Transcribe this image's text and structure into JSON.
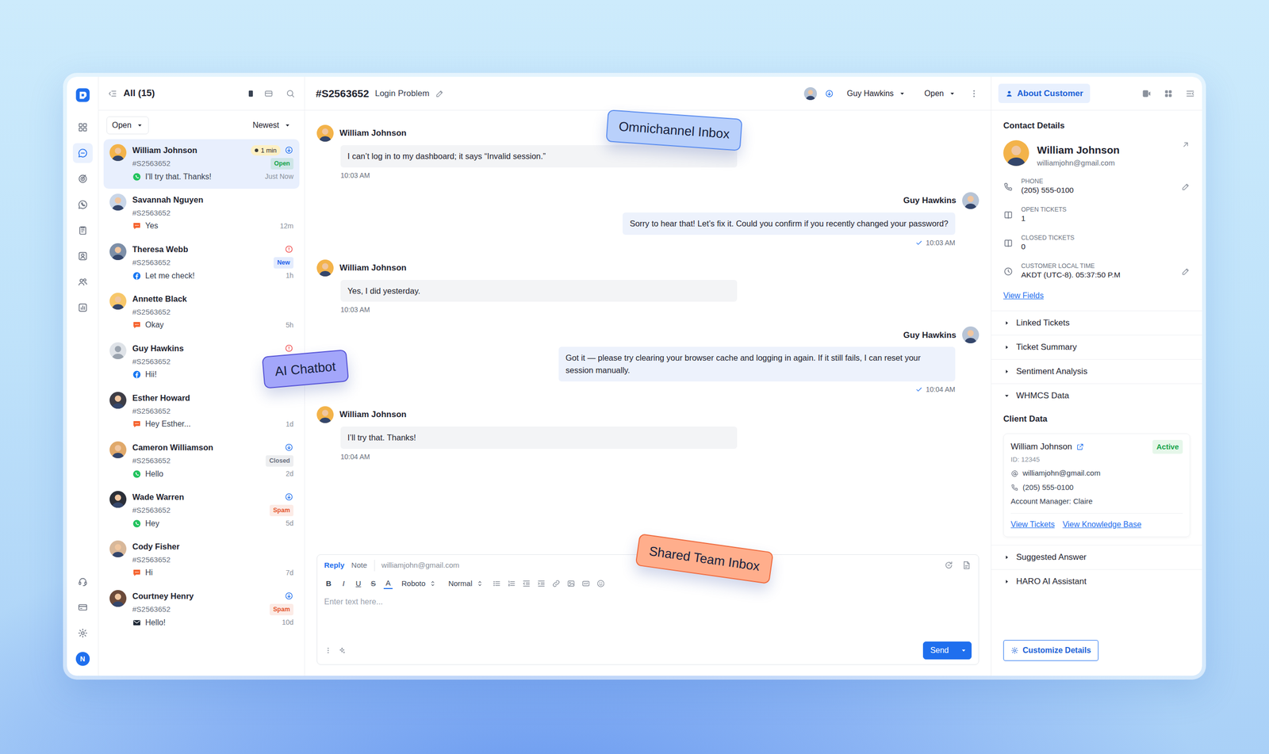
{
  "rail": {
    "items": [
      {
        "kind": "dashboard",
        "selected": false
      },
      {
        "kind": "inbox",
        "selected": true
      },
      {
        "kind": "target",
        "selected": false
      },
      {
        "kind": "whatsapp",
        "selected": false
      },
      {
        "kind": "clipboard",
        "selected": false
      },
      {
        "kind": "contact",
        "selected": false
      },
      {
        "kind": "team",
        "selected": false
      },
      {
        "kind": "reports",
        "selected": false
      }
    ],
    "bottom": [
      {
        "kind": "headset",
        "selected": false
      },
      {
        "kind": "billing",
        "selected": false
      },
      {
        "kind": "settings",
        "selected": false
      }
    ],
    "avatar": "N"
  },
  "list": {
    "title": "All (15)",
    "filter": "Open",
    "sort": "Newest",
    "views": [
      {
        "kind": "cards",
        "selected": true
      },
      {
        "kind": "rows",
        "selected": false
      }
    ]
  },
  "conversations": [
    {
      "name": "William Johnson",
      "ticket": "#S2563652",
      "message": "I'll try that. Thanks!",
      "time": "Just Now",
      "timer": "1 min",
      "badge": {
        "text": "Open",
        "color": "#16a34a"
      },
      "channel": "whatsapp",
      "assigned": true,
      "alert": false,
      "photo": true,
      "selected": true
    },
    {
      "name": "Savannah Nguyen",
      "ticket": "#S2563652",
      "message": "Yes",
      "time": "12m",
      "channel": "chat",
      "assigned": false,
      "alert": false,
      "photo": true,
      "selected": false
    },
    {
      "name": "Theresa Webb",
      "ticket": "#S2563652",
      "message": "Let me check!",
      "time": "1h",
      "badge": {
        "text": "New",
        "color": "#2563eb"
      },
      "channel": "facebook",
      "assigned": false,
      "alert": true,
      "photo": true,
      "selected": false
    },
    {
      "name": "Annette Black",
      "ticket": "#S2563652",
      "message": "Okay",
      "time": "5h",
      "channel": "chat",
      "assigned": false,
      "alert": false,
      "photo": true,
      "selected": false
    },
    {
      "name": "Guy Hawkins",
      "ticket": "#S2563652",
      "message": "Hii!",
      "channel": "facebook",
      "assigned": false,
      "alert": true,
      "photo": false,
      "selected": false
    },
    {
      "name": "Esther Howard",
      "ticket": "#S2563652",
      "message": "Hey Esther...",
      "time": "1d",
      "channel": "chat",
      "assigned": false,
      "alert": false,
      "photo": true,
      "selected": false
    },
    {
      "name": "Cameron Williamson",
      "ticket": "#S2563652",
      "message": "Hello",
      "time": "2d",
      "badge": {
        "text": "Closed",
        "color": "#6b7280"
      },
      "channel": "whatsapp",
      "assigned": true,
      "alert": false,
      "photo": true,
      "selected": false
    },
    {
      "name": "Wade Warren",
      "ticket": "#S2563652",
      "message": "Hey",
      "time": "5d",
      "badge": {
        "text": "Spam",
        "color": "#e4572e"
      },
      "channel": "whatsapp",
      "assigned": true,
      "alert": false,
      "photo": true,
      "selected": false
    },
    {
      "name": "Cody Fisher",
      "ticket": "#S2563652",
      "message": "Hi",
      "time": "7d",
      "channel": "chat",
      "assigned": false,
      "alert": false,
      "photo": true,
      "selected": false
    },
    {
      "name": "Courtney Henry",
      "ticket": "#S2563652",
      "message": "Hello!",
      "time": "10d",
      "badge": {
        "text": "Spam",
        "color": "#e4572e"
      },
      "channel": "email",
      "assigned": true,
      "alert": false,
      "photo": true,
      "selected": false
    }
  ],
  "ticket": {
    "id": "#S2563652",
    "subject": "Login Problem",
    "assignee": "Guy Hawkins",
    "status": "Open"
  },
  "messages": [
    {
      "sender": "William Johnson",
      "text": "I can’t log in to my dashboard; it says “Invalid session.”",
      "time": "10:03 AM",
      "side": "in"
    },
    {
      "sender": "Guy Hawkins",
      "text": "Sorry to hear that! Let’s fix it. Could you confirm if you recently changed your password?",
      "time": "10:03 AM",
      "side": "out",
      "read": true
    },
    {
      "sender": "William Johnson",
      "text": "Yes, I did yesterday.",
      "time": "10:03 AM",
      "side": "in"
    },
    {
      "sender": "Guy Hawkins",
      "text": "Got it — please try clearing your browser cache and logging in again. If it still fails, I can reset your session manually.",
      "time": "10:04 AM",
      "side": "out",
      "read": true
    },
    {
      "sender": "William Johnson",
      "text": "I’ll try that. Thanks!",
      "time": "10:04 AM",
      "side": "in"
    }
  ],
  "composer": {
    "tabs": [
      {
        "label": "Reply",
        "selected": true
      },
      {
        "label": "Note",
        "selected": false
      }
    ],
    "to": "williamjohn@gmail.com",
    "format": [
      {
        "label": "B",
        "kind": "bold"
      },
      {
        "label": "I",
        "kind": "italic"
      },
      {
        "label": "U",
        "kind": "underline"
      },
      {
        "label": "S",
        "kind": "strike"
      },
      {
        "label": "A",
        "kind": "color"
      }
    ],
    "font": "Roboto",
    "size": "Normal",
    "placeholder": "Enter text here...",
    "send": "Send"
  },
  "customer": {
    "tab": "About Customer",
    "heading": "Contact Details",
    "name": "William Johnson",
    "email": "williamjohn@gmail.com",
    "fields": [
      {
        "label": "PHONE",
        "value": "(205) 555-0100",
        "kind": "phone",
        "editable": true
      },
      {
        "label": "OPEN TICKETS",
        "value": "1",
        "kind": "ticket",
        "editable": false
      },
      {
        "label": "CLOSED TICKETS",
        "value": "0",
        "kind": "ticket",
        "editable": false
      },
      {
        "label": "CUSTOMER LOCAL TIME",
        "value": "AKDT (UTC-8). 05:37:50 P.M",
        "kind": "clock",
        "editable": true
      }
    ],
    "view_fields": "View Fields",
    "sections": [
      {
        "title": "Linked Tickets",
        "expanded": false
      },
      {
        "title": "Ticket Summary",
        "expanded": false
      },
      {
        "title": "Sentiment Analysis",
        "expanded": false
      },
      {
        "title": "WHMCS Data",
        "expanded": true
      },
      {
        "title": "Suggested Answer",
        "expanded": false
      },
      {
        "title": "HARO AI Assistant",
        "expanded": false
      }
    ],
    "client": {
      "title": "Client Data",
      "name": "William Johnson",
      "status": "Active",
      "id": "ID: 12345",
      "email": "williamjohn@gmail.com",
      "phone": "(205) 555-0100",
      "manager": "Account Manager: Claire",
      "links": [
        "View Tickets",
        "View Knowledge Base"
      ]
    },
    "customize": "Customize Details"
  },
  "tags": [
    {
      "text": "Omnichannel Inbox",
      "color": "#b9d0fb"
    },
    {
      "text": "AI Chatbot",
      "color": "#a3a6fa"
    },
    {
      "text": "Shared Team Inbox",
      "color": "#ffae8c"
    }
  ]
}
